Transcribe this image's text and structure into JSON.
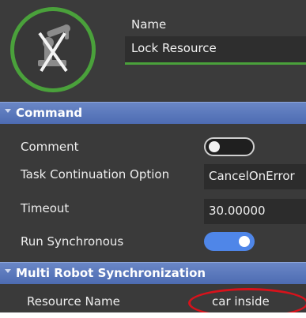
{
  "header": {
    "name_label": "Name",
    "name_value": "Lock Resource",
    "icon": "robot-arm-crossed-icon"
  },
  "sections": {
    "command": "Command",
    "multi_robot": "Multi Robot Synchronization"
  },
  "properties": {
    "comment": {
      "label": "Comment",
      "toggle": "off"
    },
    "task_continuation": {
      "label": "Task Continuation Option",
      "value": "CancelOnError"
    },
    "timeout": {
      "label": "Timeout",
      "value": "30.00000"
    },
    "run_synchronous": {
      "label": "Run Synchronous",
      "toggle": "on"
    },
    "resource_name": {
      "label": "Resource Name",
      "value": "car inside"
    }
  },
  "colors": {
    "accent_green": "#4aa13b",
    "section_blue": "#5b78bb",
    "toggle_on": "#4f86e8",
    "highlight_red": "#d8121b"
  }
}
